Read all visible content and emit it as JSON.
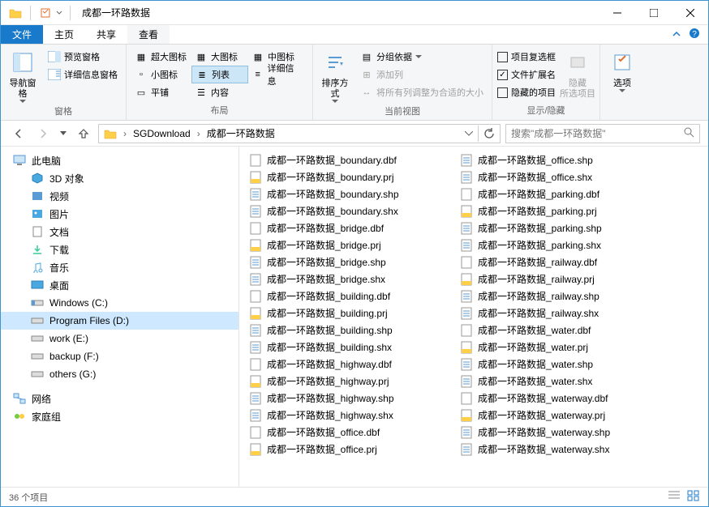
{
  "window": {
    "title": "成都一环路数据"
  },
  "tabs": {
    "file": "文件",
    "home": "主页",
    "share": "共享",
    "view": "查看"
  },
  "ribbon": {
    "group_panes": "窗格",
    "nav_pane": "导航窗格",
    "preview_pane": "预览窗格",
    "details_pane": "详细信息窗格",
    "group_layout": "布局",
    "extra_large": "超大图标",
    "large": "大图标",
    "medium": "中图标",
    "small": "小图标",
    "list": "列表",
    "details": "详细信息",
    "tiles": "平铺",
    "content": "内容",
    "group_current": "当前视图",
    "sort_by": "排序方式",
    "group_by": "分组依据",
    "add_columns": "添加列",
    "size_all": "将所有列调整为合适的大小",
    "group_showhide": "显示/隐藏",
    "item_checkboxes": "项目复选框",
    "file_ext": "文件扩展名",
    "hidden_items": "隐藏的项目",
    "hide_selected": "隐藏\n所选项目",
    "options": "选项"
  },
  "breadcrumb": {
    "seg1": "SGDownload",
    "seg2": "成都一环路数据"
  },
  "nav": {
    "refresh": "刷新"
  },
  "search": {
    "placeholder": "搜索\"成都一环路数据\""
  },
  "tree": {
    "this_pc": "此电脑",
    "objects_3d": "3D 对象",
    "videos": "视频",
    "pictures": "图片",
    "documents": "文档",
    "downloads": "下载",
    "music": "音乐",
    "desktop": "桌面",
    "c_drive": "Windows (C:)",
    "d_drive": "Program Files (D:)",
    "e_drive": "work (E:)",
    "f_drive": "backup (F:)",
    "g_drive": "others (G:)",
    "network": "网络",
    "homegroup": "家庭组"
  },
  "files": {
    "col1": [
      {
        "name": "成都一环路数据_boundary.dbf",
        "type": "dbf"
      },
      {
        "name": "成都一环路数据_boundary.prj",
        "type": "prj"
      },
      {
        "name": "成都一环路数据_boundary.shp",
        "type": "shp"
      },
      {
        "name": "成都一环路数据_boundary.shx",
        "type": "shx"
      },
      {
        "name": "成都一环路数据_bridge.dbf",
        "type": "dbf"
      },
      {
        "name": "成都一环路数据_bridge.prj",
        "type": "prj"
      },
      {
        "name": "成都一环路数据_bridge.shp",
        "type": "shp"
      },
      {
        "name": "成都一环路数据_bridge.shx",
        "type": "shx"
      },
      {
        "name": "成都一环路数据_building.dbf",
        "type": "dbf"
      },
      {
        "name": "成都一环路数据_building.prj",
        "type": "prj"
      },
      {
        "name": "成都一环路数据_building.shp",
        "type": "shp"
      },
      {
        "name": "成都一环路数据_building.shx",
        "type": "shx"
      },
      {
        "name": "成都一环路数据_highway.dbf",
        "type": "dbf"
      },
      {
        "name": "成都一环路数据_highway.prj",
        "type": "prj"
      },
      {
        "name": "成都一环路数据_highway.shp",
        "type": "shp"
      },
      {
        "name": "成都一环路数据_highway.shx",
        "type": "shx"
      },
      {
        "name": "成都一环路数据_office.dbf",
        "type": "dbf"
      },
      {
        "name": "成都一环路数据_office.prj",
        "type": "prj"
      }
    ],
    "col2": [
      {
        "name": "成都一环路数据_office.shp",
        "type": "shp"
      },
      {
        "name": "成都一环路数据_office.shx",
        "type": "shx"
      },
      {
        "name": "成都一环路数据_parking.dbf",
        "type": "dbf"
      },
      {
        "name": "成都一环路数据_parking.prj",
        "type": "prj"
      },
      {
        "name": "成都一环路数据_parking.shp",
        "type": "shp"
      },
      {
        "name": "成都一环路数据_parking.shx",
        "type": "shx"
      },
      {
        "name": "成都一环路数据_railway.dbf",
        "type": "dbf"
      },
      {
        "name": "成都一环路数据_railway.prj",
        "type": "prj"
      },
      {
        "name": "成都一环路数据_railway.shp",
        "type": "shp"
      },
      {
        "name": "成都一环路数据_railway.shx",
        "type": "shx"
      },
      {
        "name": "成都一环路数据_water.dbf",
        "type": "dbf"
      },
      {
        "name": "成都一环路数据_water.prj",
        "type": "prj"
      },
      {
        "name": "成都一环路数据_water.shp",
        "type": "shp"
      },
      {
        "name": "成都一环路数据_water.shx",
        "type": "shx"
      },
      {
        "name": "成都一环路数据_waterway.dbf",
        "type": "dbf"
      },
      {
        "name": "成都一环路数据_waterway.prj",
        "type": "prj"
      },
      {
        "name": "成都一环路数据_waterway.shp",
        "type": "shp"
      },
      {
        "name": "成都一环路数据_waterway.shx",
        "type": "shx"
      }
    ]
  },
  "status": {
    "count": "36 个项目"
  }
}
